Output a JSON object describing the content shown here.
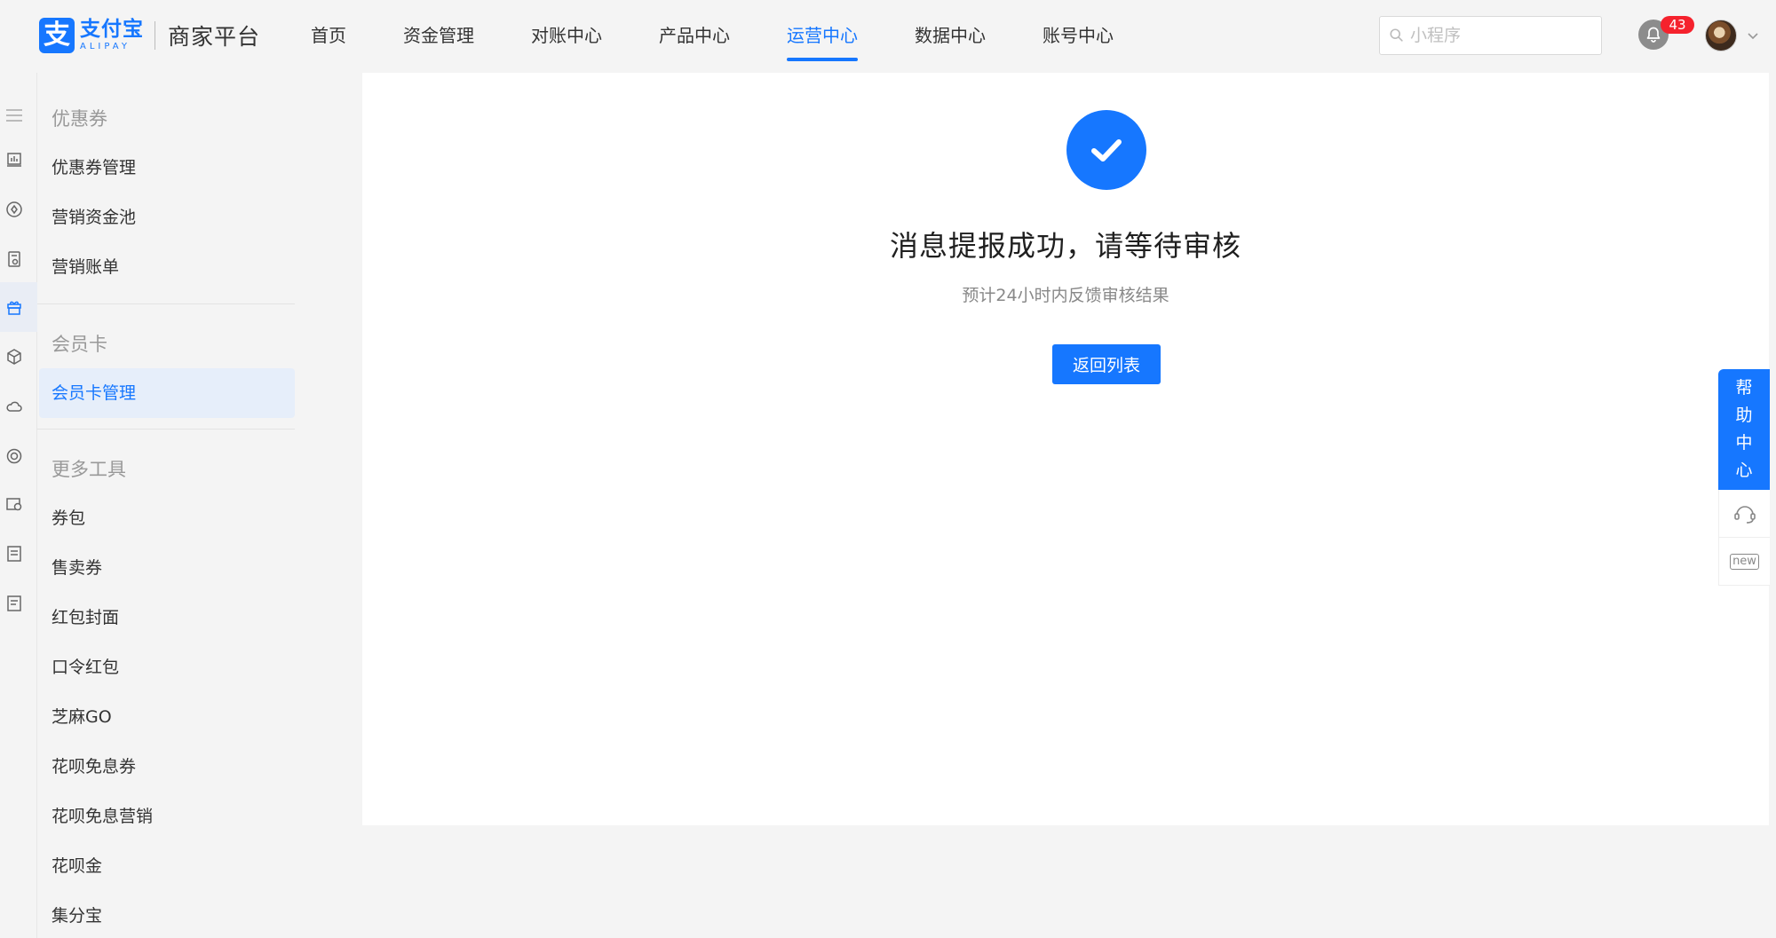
{
  "brand": {
    "logo_char": "支",
    "name_cn": "支付宝",
    "name_en": "ALIPAY",
    "platform": "商家平台",
    "color": "#1677ff"
  },
  "topnav": {
    "items": [
      "首页",
      "资金管理",
      "对账中心",
      "产品中心",
      "运营中心",
      "数据中心",
      "账号中心"
    ],
    "active": "运营中心"
  },
  "search": {
    "placeholder": "小程序",
    "value": ""
  },
  "notifications": {
    "count": "43"
  },
  "rail": {
    "icons": [
      "menu-icon",
      "chart-icon",
      "target-icon",
      "document-icon",
      "gift-icon",
      "cube-icon",
      "cloud-icon",
      "badge-icon",
      "wallet-icon",
      "list-icon",
      "notes-icon"
    ],
    "active": "gift-icon"
  },
  "sidebar": {
    "groups": [
      {
        "title": "优惠券",
        "items": [
          "优惠券管理",
          "营销资金池",
          "营销账单"
        ]
      },
      {
        "title": "会员卡",
        "items": [
          "会员卡管理"
        ]
      },
      {
        "title": "更多工具",
        "items": [
          "券包",
          "售卖券",
          "红包封面",
          "口令红包",
          "芝麻GO",
          "花呗免息券",
          "花呗免息营销",
          "花呗金",
          "集分宝"
        ]
      }
    ],
    "active": "会员卡管理"
  },
  "result": {
    "status": "success",
    "title": "消息提报成功，请等待审核",
    "subtitle": "预计24小时内反馈审核结果",
    "button_label": "返回列表"
  },
  "help": {
    "chars": [
      "帮",
      "助",
      "中",
      "心"
    ],
    "new_label": "new"
  },
  "colors": {
    "primary": "#1677ff",
    "badge": "#f5222d",
    "background": "#f4f4f4",
    "active_item_bg": "#e6eefa"
  }
}
